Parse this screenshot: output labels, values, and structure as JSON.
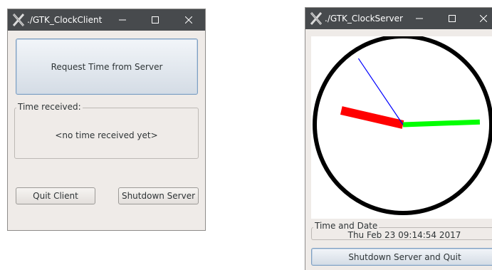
{
  "client": {
    "title": "./GTK_ClockClient",
    "request_button": "Request Time from Server",
    "time_frame_label": "Time received:",
    "time_value": "<no time received yet>",
    "quit_button": "Quit Client",
    "shutdown_button": "Shutdown Server"
  },
  "server": {
    "title": "./GTK_ClockServer",
    "clock": {
      "hour_hand_angle_deg": 283,
      "minute_hand_angle_deg": 88,
      "second_hand_angle_deg": 326,
      "face_color": "#ffffff",
      "rim_color": "#000000",
      "hour_hand_color": "#ff0000",
      "minute_hand_color": "#00ff00",
      "second_hand_color": "#0000ff"
    },
    "date_frame_label": "Time and Date",
    "date_value": "Thu Feb 23 09:14:54 2017",
    "shutdown_quit_button": "Shutdown Server and Quit"
  },
  "icons": {
    "app_icon": "gtk-x-icon",
    "minimize": "minimize-icon",
    "maximize": "maximize-icon",
    "close": "close-icon"
  },
  "colors": {
    "titlebar": "#474a4d",
    "window_bg": "#efebe8"
  }
}
